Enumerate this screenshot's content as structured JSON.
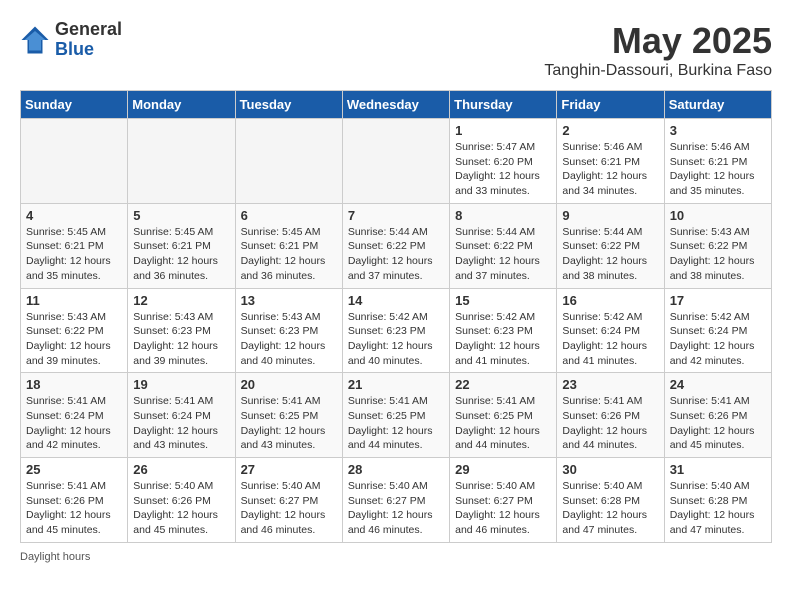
{
  "logo": {
    "general": "General",
    "blue": "Blue"
  },
  "title": "May 2025",
  "location": "Tanghin-Dassouri, Burkina Faso",
  "days_of_week": [
    "Sunday",
    "Monday",
    "Tuesday",
    "Wednesday",
    "Thursday",
    "Friday",
    "Saturday"
  ],
  "weeks": [
    [
      {
        "day": "",
        "info": ""
      },
      {
        "day": "",
        "info": ""
      },
      {
        "day": "",
        "info": ""
      },
      {
        "day": "",
        "info": ""
      },
      {
        "day": "1",
        "info": "Sunrise: 5:47 AM\nSunset: 6:20 PM\nDaylight: 12 hours\nand 33 minutes."
      },
      {
        "day": "2",
        "info": "Sunrise: 5:46 AM\nSunset: 6:21 PM\nDaylight: 12 hours\nand 34 minutes."
      },
      {
        "day": "3",
        "info": "Sunrise: 5:46 AM\nSunset: 6:21 PM\nDaylight: 12 hours\nand 35 minutes."
      }
    ],
    [
      {
        "day": "4",
        "info": "Sunrise: 5:45 AM\nSunset: 6:21 PM\nDaylight: 12 hours\nand 35 minutes."
      },
      {
        "day": "5",
        "info": "Sunrise: 5:45 AM\nSunset: 6:21 PM\nDaylight: 12 hours\nand 36 minutes."
      },
      {
        "day": "6",
        "info": "Sunrise: 5:45 AM\nSunset: 6:21 PM\nDaylight: 12 hours\nand 36 minutes."
      },
      {
        "day": "7",
        "info": "Sunrise: 5:44 AM\nSunset: 6:22 PM\nDaylight: 12 hours\nand 37 minutes."
      },
      {
        "day": "8",
        "info": "Sunrise: 5:44 AM\nSunset: 6:22 PM\nDaylight: 12 hours\nand 37 minutes."
      },
      {
        "day": "9",
        "info": "Sunrise: 5:44 AM\nSunset: 6:22 PM\nDaylight: 12 hours\nand 38 minutes."
      },
      {
        "day": "10",
        "info": "Sunrise: 5:43 AM\nSunset: 6:22 PM\nDaylight: 12 hours\nand 38 minutes."
      }
    ],
    [
      {
        "day": "11",
        "info": "Sunrise: 5:43 AM\nSunset: 6:22 PM\nDaylight: 12 hours\nand 39 minutes."
      },
      {
        "day": "12",
        "info": "Sunrise: 5:43 AM\nSunset: 6:23 PM\nDaylight: 12 hours\nand 39 minutes."
      },
      {
        "day": "13",
        "info": "Sunrise: 5:43 AM\nSunset: 6:23 PM\nDaylight: 12 hours\nand 40 minutes."
      },
      {
        "day": "14",
        "info": "Sunrise: 5:42 AM\nSunset: 6:23 PM\nDaylight: 12 hours\nand 40 minutes."
      },
      {
        "day": "15",
        "info": "Sunrise: 5:42 AM\nSunset: 6:23 PM\nDaylight: 12 hours\nand 41 minutes."
      },
      {
        "day": "16",
        "info": "Sunrise: 5:42 AM\nSunset: 6:24 PM\nDaylight: 12 hours\nand 41 minutes."
      },
      {
        "day": "17",
        "info": "Sunrise: 5:42 AM\nSunset: 6:24 PM\nDaylight: 12 hours\nand 42 minutes."
      }
    ],
    [
      {
        "day": "18",
        "info": "Sunrise: 5:41 AM\nSunset: 6:24 PM\nDaylight: 12 hours\nand 42 minutes."
      },
      {
        "day": "19",
        "info": "Sunrise: 5:41 AM\nSunset: 6:24 PM\nDaylight: 12 hours\nand 43 minutes."
      },
      {
        "day": "20",
        "info": "Sunrise: 5:41 AM\nSunset: 6:25 PM\nDaylight: 12 hours\nand 43 minutes."
      },
      {
        "day": "21",
        "info": "Sunrise: 5:41 AM\nSunset: 6:25 PM\nDaylight: 12 hours\nand 44 minutes."
      },
      {
        "day": "22",
        "info": "Sunrise: 5:41 AM\nSunset: 6:25 PM\nDaylight: 12 hours\nand 44 minutes."
      },
      {
        "day": "23",
        "info": "Sunrise: 5:41 AM\nSunset: 6:26 PM\nDaylight: 12 hours\nand 44 minutes."
      },
      {
        "day": "24",
        "info": "Sunrise: 5:41 AM\nSunset: 6:26 PM\nDaylight: 12 hours\nand 45 minutes."
      }
    ],
    [
      {
        "day": "25",
        "info": "Sunrise: 5:41 AM\nSunset: 6:26 PM\nDaylight: 12 hours\nand 45 minutes."
      },
      {
        "day": "26",
        "info": "Sunrise: 5:40 AM\nSunset: 6:26 PM\nDaylight: 12 hours\nand 45 minutes."
      },
      {
        "day": "27",
        "info": "Sunrise: 5:40 AM\nSunset: 6:27 PM\nDaylight: 12 hours\nand 46 minutes."
      },
      {
        "day": "28",
        "info": "Sunrise: 5:40 AM\nSunset: 6:27 PM\nDaylight: 12 hours\nand 46 minutes."
      },
      {
        "day": "29",
        "info": "Sunrise: 5:40 AM\nSunset: 6:27 PM\nDaylight: 12 hours\nand 46 minutes."
      },
      {
        "day": "30",
        "info": "Sunrise: 5:40 AM\nSunset: 6:28 PM\nDaylight: 12 hours\nand 47 minutes."
      },
      {
        "day": "31",
        "info": "Sunrise: 5:40 AM\nSunset: 6:28 PM\nDaylight: 12 hours\nand 47 minutes."
      }
    ]
  ],
  "footer": {
    "daylight_hours_label": "Daylight hours"
  }
}
